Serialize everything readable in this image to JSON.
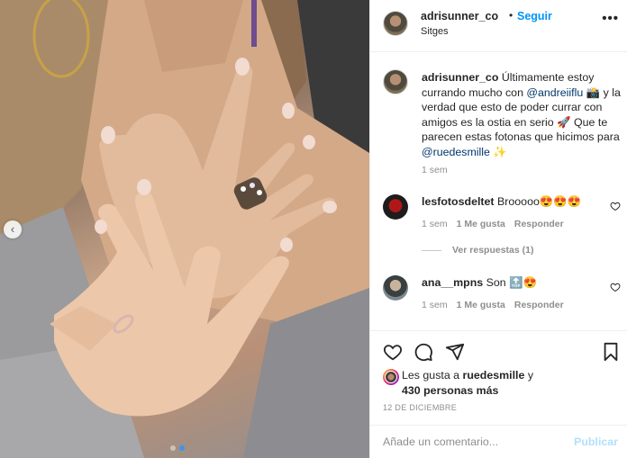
{
  "post": {
    "username": "adrisunner_co",
    "separator": "•",
    "follow_label": "Seguir",
    "location": "Sitges",
    "more_label": "•••"
  },
  "caption": {
    "username": "adrisunner_co",
    "text_1": " Últimamente estoy currando mucho con ",
    "mention_1": "@andreiiflu",
    "text_2": " 📸 y la verdad que esto de poder currar con amigos es la ostia en serio 🚀 Que te parecen estas fotonas que hicimos para ",
    "mention_2": "@ruedesmille",
    "text_3": " ✨",
    "time": "1 sem"
  },
  "comments": [
    {
      "username": "lesfotosdeltet",
      "text": " Brooooo😍😍😍",
      "time": "1 sem",
      "likes": "1 Me gusta",
      "reply_label": "Responder",
      "view_replies": "Ver respuestas (1)"
    },
    {
      "username": "ana__mpns",
      "text": " Son 🔝😍",
      "time": "1 sem",
      "likes": "1 Me gusta",
      "reply_label": "Responder"
    }
  ],
  "likes": {
    "prefix": "Les gusta a ",
    "username": "ruedesmille",
    "connector": " y",
    "others": "430 personas más"
  },
  "date": "12 DE DICIEMBRE",
  "add_comment": {
    "placeholder": "Añade un comentario...",
    "publish_label": "Publicar"
  },
  "colors": {
    "accent": "#0095f6",
    "mention": "#00376b",
    "secondary_text": "#8e8e8e",
    "publish_disabled": "#b2dffc"
  },
  "icons": [
    "heart-icon",
    "comment-icon",
    "share-icon",
    "bookmark-icon",
    "more-options-icon",
    "chevron-left-icon"
  ],
  "carousel": {
    "slide_count": 2,
    "current_slide": 2
  }
}
